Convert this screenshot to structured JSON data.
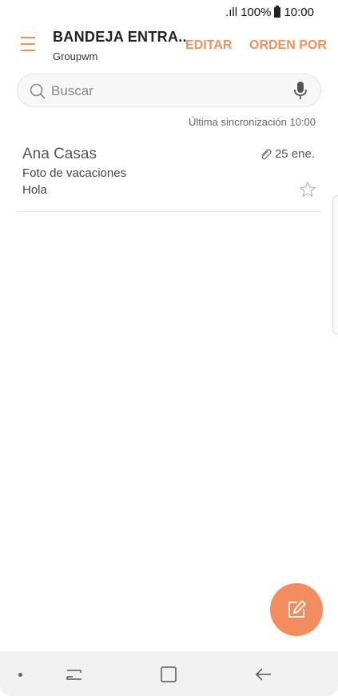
{
  "status_bar": {
    "signal": ".ıll",
    "battery_percent": "100%",
    "time": "10:00"
  },
  "header": {
    "title": "BANDEJA ENTRA..",
    "account": "Groupwm",
    "edit_label": "EDITAR",
    "sort_label": "ORDEN POR"
  },
  "search": {
    "placeholder": "Buscar"
  },
  "sync": {
    "text": "Última sincronización  10:00"
  },
  "emails": [
    {
      "sender": "Ana Casas",
      "date": "25 ene.",
      "subject": "Foto de vacaciones",
      "preview": "Hola",
      "has_attachment": true,
      "starred": false
    }
  ],
  "colors": {
    "accent": "#f0905a",
    "fab": "#f38d5e"
  },
  "icons": {
    "menu": "hamburger-icon",
    "search": "search-icon",
    "mic": "mic-icon",
    "attachment": "paperclip-icon",
    "star": "star-icon",
    "compose": "compose-icon"
  }
}
